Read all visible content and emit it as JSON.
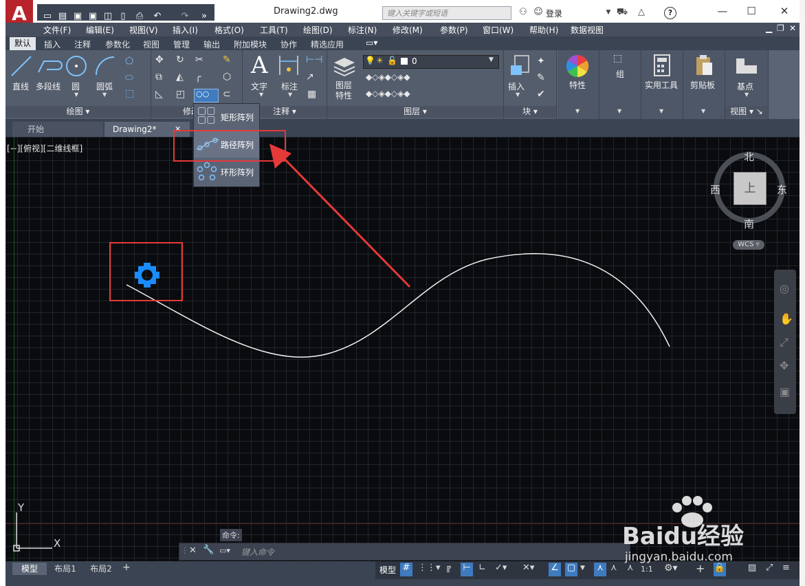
{
  "window": {
    "title": "Drawing2.dwg",
    "search_placeholder": "键入关键字或短语",
    "login_label": "登录",
    "help_label": "?"
  },
  "menu": [
    "文件(F)",
    "编辑(E)",
    "视图(V)",
    "插入(I)",
    "格式(O)",
    "工具(T)",
    "绘图(D)",
    "标注(N)",
    "修改(M)",
    "参数(P)",
    "窗口(W)",
    "帮助(H)",
    "数据视图"
  ],
  "ribbon_tabs": [
    "默认",
    "插入",
    "注释",
    "参数化",
    "视图",
    "管理",
    "输出",
    "附加模块",
    "协作",
    "精选应用"
  ],
  "ribbon": {
    "draw_panel": {
      "label": "绘图",
      "buttons": [
        "直线",
        "多段线",
        "圆",
        "圆弧"
      ]
    },
    "modify_panel": {
      "label": "修改"
    },
    "annotation_panel": {
      "label": "注释",
      "buttons": [
        "文字",
        "标注"
      ]
    },
    "layers_panel": {
      "label": "图层",
      "layer_properties_label": "图层\n特性",
      "current_layer": "0"
    },
    "block_panel": {
      "label": "块",
      "insert_label": "插入"
    },
    "properties_label": "特性",
    "group_label": "组",
    "utilities_label": "实用工具",
    "clipboard_label": "剪贴板",
    "view_panel": {
      "label": "视图",
      "base_label": "基点"
    }
  },
  "array_menu": [
    "矩形阵列",
    "路径阵列",
    "环形阵列"
  ],
  "doc_tabs": [
    "开始",
    "Drawing2*"
  ],
  "viewport_label": "[−][俯视][二维线框]",
  "viewcube": {
    "north": "北",
    "south": "南",
    "east": "东",
    "west": "西",
    "top": "上",
    "wcs": "WCS"
  },
  "ucs": {
    "x": "X",
    "y": "Y"
  },
  "command": {
    "label": "命令:",
    "placeholder": "键入命令"
  },
  "layout_tabs": [
    "模型",
    "布局1",
    "布局2"
  ],
  "status": {
    "model": "模型",
    "scale": "1:1"
  },
  "watermark": {
    "brand": "Baidu经验",
    "url": "jingyan.baidu.com"
  },
  "colors": {
    "highlight_red": "#e53a3a",
    "accent_blue": "#1a8cff",
    "canvas_bg": "#0a0b0e"
  }
}
